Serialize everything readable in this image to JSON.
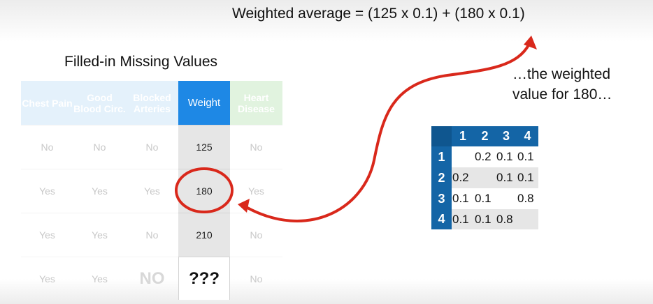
{
  "formula": "Weighted average = (125 x 0.1) + (180 x 0.1)",
  "table_title": "Filled-in Missing Values",
  "note": "…the weighted value for 180…",
  "headers": [
    "Chest Pain",
    "Good Blood Circ.",
    "Blocked Arteries",
    "Weight",
    "Heart Disease"
  ],
  "rows": [
    [
      "No",
      "No",
      "No",
      "125",
      "No"
    ],
    [
      "Yes",
      "Yes",
      "Yes",
      "180",
      "Yes"
    ],
    [
      "Yes",
      "Yes",
      "No",
      "210",
      "No"
    ],
    [
      "Yes",
      "Yes",
      "NO",
      "???",
      "No"
    ]
  ],
  "matrix": {
    "col_headers": [
      "1",
      "2",
      "3",
      "4"
    ],
    "row_headers": [
      "1",
      "2",
      "3",
      "4"
    ],
    "cells": [
      [
        "",
        "0.2",
        "0.1",
        "0.1"
      ],
      [
        "0.2",
        "",
        "0.1",
        "0.1"
      ],
      [
        "0.1",
        "0.1",
        "",
        "0.8"
      ],
      [
        "0.1",
        "0.1",
        "0.8",
        ""
      ]
    ]
  },
  "colors": {
    "weight_header": "#1e88e5",
    "matrix_header": "#1465a6",
    "arrow_red": "#d9281b"
  }
}
